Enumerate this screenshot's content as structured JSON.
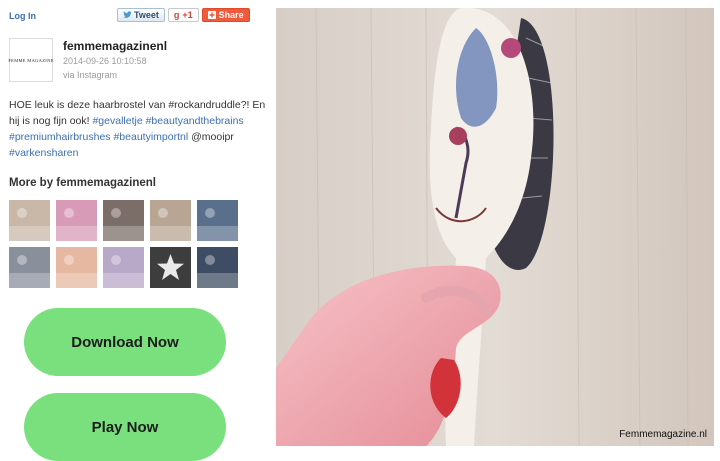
{
  "header": {
    "login_label": "Log In"
  },
  "share": {
    "tweet_label": "Tweet",
    "gplus_label": "+1",
    "share_label": "Share"
  },
  "profile": {
    "avatar_text": "FEMME MAGAZINE",
    "username": "femmemagazinenl",
    "timestamp": "2014-09-26 10:10:58",
    "via": "via Instagram"
  },
  "caption": {
    "text": "HOE leuk is deze haarbrostel van #rockandruddle?! En hij is nog fijn ook!",
    "tags": [
      "#gevalletje",
      "#beautyandthebrains",
      "#premiumhairbrushes",
      "#beautyimportnl"
    ],
    "mention": "@mooipr",
    "last_tag": "#varkensharen"
  },
  "more": {
    "title": "More by femmemagazinenl"
  },
  "thumbnails": [
    {
      "icon": "photo-thumbnail",
      "color": "#c9b7a8"
    },
    {
      "icon": "photo-thumbnail",
      "color": "#d89bb7"
    },
    {
      "icon": "photo-thumbnail",
      "color": "#7b6e68"
    },
    {
      "icon": "photo-thumbnail",
      "color": "#b8a594"
    },
    {
      "icon": "photo-thumbnail",
      "color": "#5a6f8c"
    },
    {
      "icon": "photo-thumbnail",
      "color": "#8a8f9c"
    },
    {
      "icon": "photo-thumbnail",
      "color": "#e7b8a1"
    },
    {
      "icon": "photo-thumbnail",
      "color": "#b9a9c9"
    },
    {
      "icon": "star-thumbnail",
      "color": "#3d3d3d"
    },
    {
      "icon": "photo-thumbnail",
      "color": "#3e4d63"
    }
  ],
  "actions": {
    "download_label": "Download Now",
    "play_label": "Play Now"
  },
  "photo": {
    "watermark": "Femmemagazine.nl"
  },
  "colors": {
    "accent_link": "#3b6fb6",
    "cta_green": "#79e07d"
  }
}
